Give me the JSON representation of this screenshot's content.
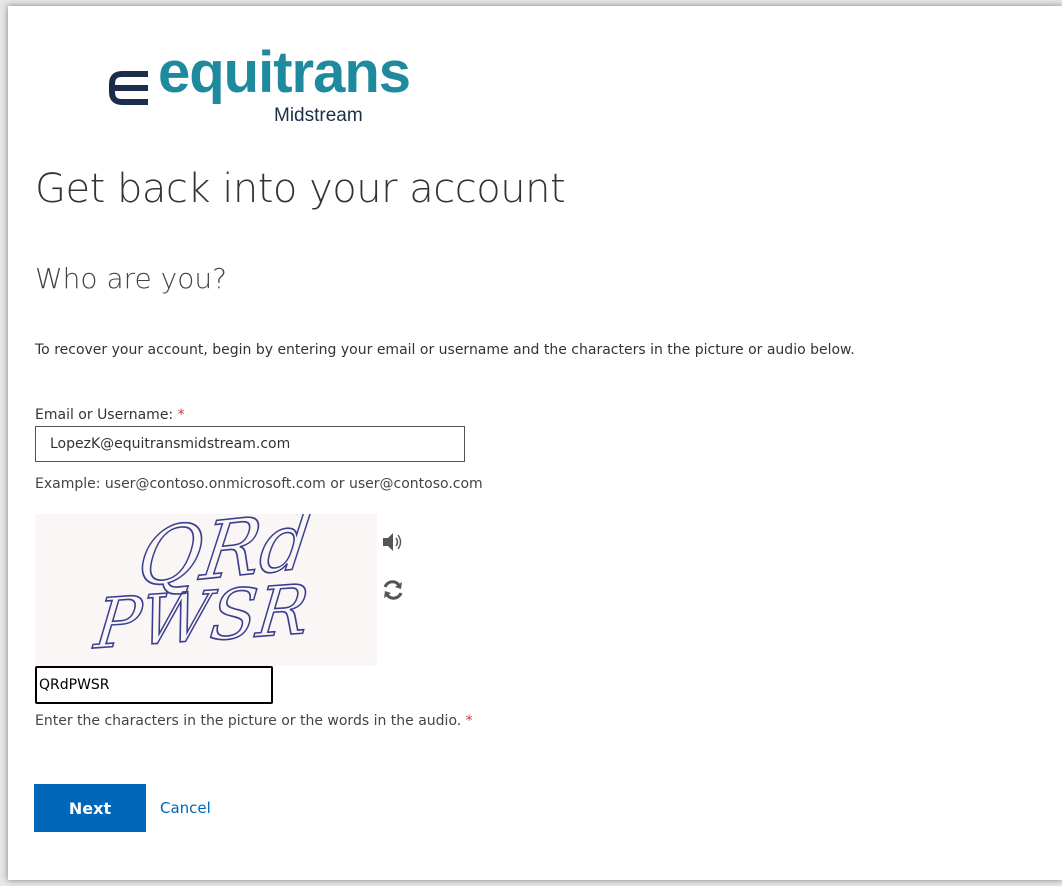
{
  "brand": {
    "logo_word": "equitrans",
    "logo_sub": "Midstream",
    "primary_color": "#1d8a9e",
    "secondary_color": "#1a2e4a"
  },
  "page": {
    "title": "Get back into your account",
    "subtitle": "Who are you?",
    "intro": "To recover your account, begin by entering your email or username and the characters in the picture or audio below."
  },
  "email_field": {
    "label": "Email or Username:",
    "required_marker": "*",
    "value": "LopezK@equitransmidstream.com",
    "example": "Example: user@contoso.onmicrosoft.com or user@contoso.com"
  },
  "captcha": {
    "image_text_line1": "QRd",
    "image_text_line2": "PWSR",
    "audio_icon": "speaker-icon",
    "refresh_icon": "refresh-icon",
    "input_value": "QRdPWSR",
    "hint": "Enter the characters in the picture or the words in the audio.",
    "required_marker": "*"
  },
  "actions": {
    "next_label": "Next",
    "cancel_label": "Cancel",
    "accent_color": "#0067b8"
  }
}
